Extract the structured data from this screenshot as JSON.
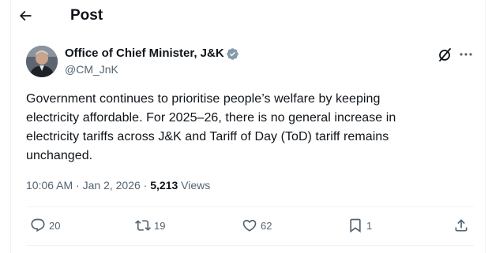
{
  "header": {
    "title": "Post",
    "back_icon": "arrow-left-icon"
  },
  "post": {
    "author_name": "Office of Chief Minister, J&K",
    "author_handle": "@CM_JnK",
    "verified_color": "#829aab",
    "text": "Government continues to prioritise people’s welfare by keeping\nelectricity affordable. For 2025–26, there is no general increase in\nelectricity tariffs across J&K and Tariff of Day (ToD) tariff remains\nunchanged.",
    "time": "10:06 AM",
    "sep1": " · ",
    "date": "Jan 2, 2026",
    "sep2": " · ",
    "views_count": "5,213",
    "views_label": " Views"
  },
  "actions": {
    "replies": "20",
    "reposts": "19",
    "likes": "62",
    "bookmarks": "1"
  },
  "colors": {
    "text": "#0f1419",
    "secondary": "#536471",
    "border": "#eff3f4"
  }
}
